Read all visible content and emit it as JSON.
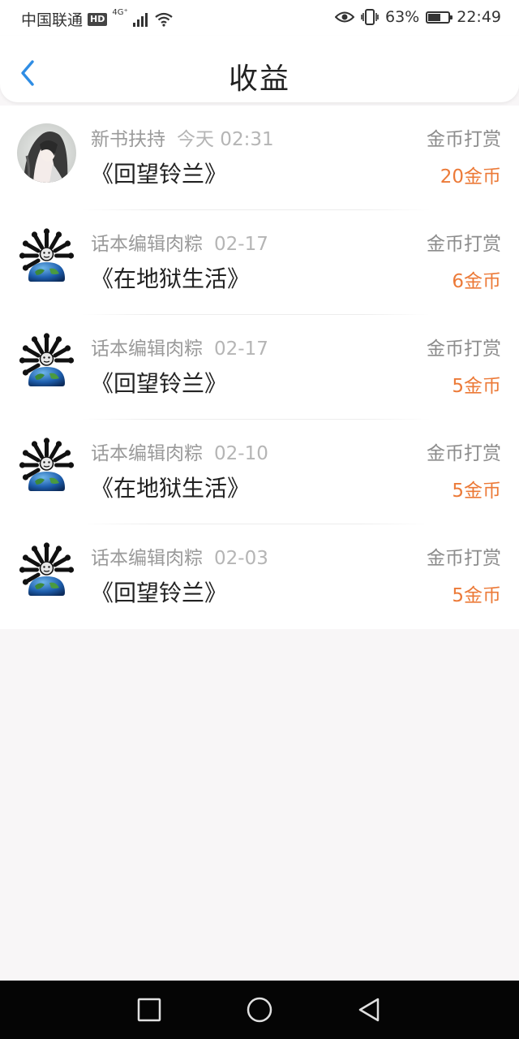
{
  "status_bar": {
    "carrier": "中国联通",
    "hd": "HD",
    "network": "4G⁺",
    "battery_pct": "63%",
    "battery_level": 0.63,
    "time": "22:49"
  },
  "header": {
    "title": "收益"
  },
  "items": [
    {
      "user": "新书扶持",
      "time": "今天 02:31",
      "book": "《回望铃兰》",
      "reward_type": "金币打赏",
      "amount": "20金币",
      "avatar": "illustrated-character-avatar"
    },
    {
      "user": "话本编辑肉粽",
      "time": "02-17",
      "book": "《在地狱生活》",
      "reward_type": "金币打赏",
      "amount": "6金币",
      "avatar": "earth-bones-avatar"
    },
    {
      "user": "话本编辑肉粽",
      "time": "02-17",
      "book": "《回望铃兰》",
      "reward_type": "金币打赏",
      "amount": "5金币",
      "avatar": "earth-bones-avatar"
    },
    {
      "user": "话本编辑肉粽",
      "time": "02-10",
      "book": "《在地狱生活》",
      "reward_type": "金币打赏",
      "amount": "5金币",
      "avatar": "earth-bones-avatar"
    },
    {
      "user": "话本编辑肉粽",
      "time": "02-03",
      "book": "《回望铃兰》",
      "reward_type": "金币打赏",
      "amount": "5金币",
      "avatar": "earth-bones-avatar"
    }
  ],
  "colors": {
    "accent_back": "#2f8de4",
    "amount": "#ec7a38",
    "background": "#f8f6f7"
  },
  "nav": {
    "recent": "square-icon",
    "home": "circle-icon",
    "back": "triangle-back-icon"
  }
}
